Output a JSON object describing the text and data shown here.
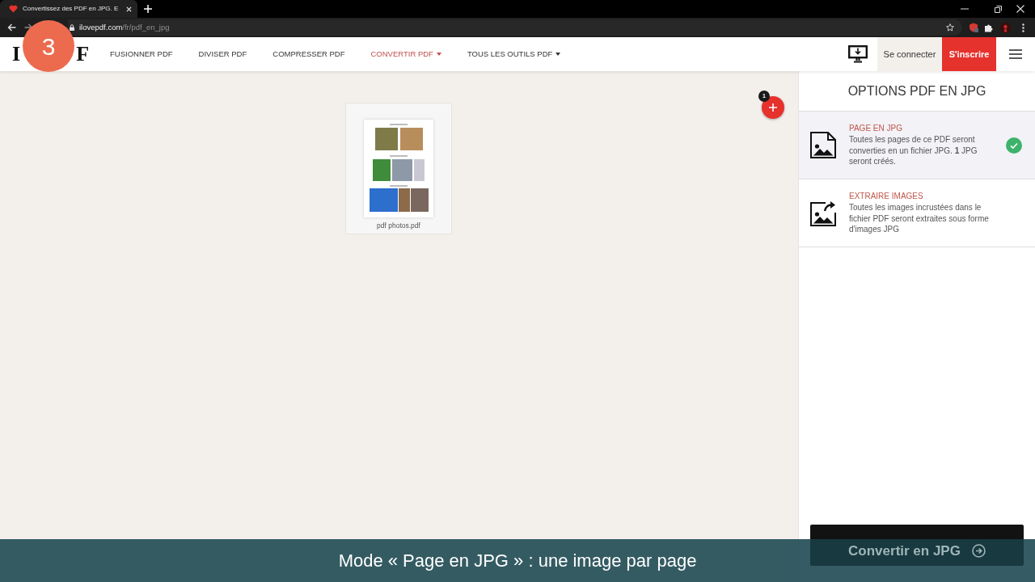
{
  "browser": {
    "tab": {
      "title": "Convertissez des PDF en JPG. E"
    },
    "address": {
      "host": "ilovepdf.com",
      "path": "/fr/pdf_en_jpg"
    }
  },
  "step_marker": {
    "number": "3"
  },
  "header": {
    "logo_left": "I",
    "logo_right": "F",
    "nav": [
      {
        "label": "FUSIONNER PDF",
        "selected": false,
        "has_menu": false
      },
      {
        "label": "DIVISER PDF",
        "selected": false,
        "has_menu": false
      },
      {
        "label": "COMPRESSER PDF",
        "selected": false,
        "has_menu": false
      },
      {
        "label": "CONVERTIR PDF",
        "selected": true,
        "has_menu": true
      },
      {
        "label": "TOUS LES OUTILS PDF",
        "selected": false,
        "has_menu": true
      }
    ],
    "login": "Se connecter",
    "signup": "S'inscrire"
  },
  "workspace": {
    "files": [
      {
        "name": "pdf photos.pdf"
      }
    ],
    "add_button": {
      "count": "1"
    }
  },
  "options_panel": {
    "title": "OPTIONS PDF EN JPG",
    "options": [
      {
        "kind": "page",
        "title": "PAGE EN JPG",
        "description": "Toutes les pages de ce PDF seront converties en un fichier JPG. **1** JPG seront créés.",
        "selected": true
      },
      {
        "kind": "extract",
        "title": "EXTRAIRE IMAGES",
        "description": "Toutes les images incrustées dans le fichier PDF seront extraites sous forme d'images JPG",
        "selected": false
      }
    ],
    "convert_button": "Convertir en JPG"
  },
  "caption": "Mode « Page en JPG » : une image par page"
}
